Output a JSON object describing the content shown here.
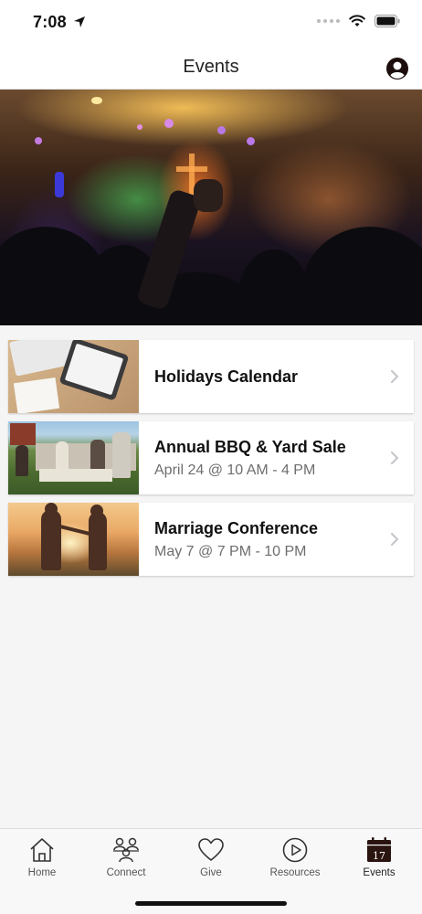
{
  "status": {
    "time": "7:08"
  },
  "header": {
    "title": "Events"
  },
  "events": [
    {
      "title": "Holidays Calendar",
      "subtitle": ""
    },
    {
      "title": "Annual BBQ & Yard Sale",
      "subtitle": "April 24 @ 10 AM - 4 PM"
    },
    {
      "title": "Marriage Conference",
      "subtitle": "May 7 @ 7 PM - 10 PM"
    }
  ],
  "tabs": [
    {
      "label": "Home",
      "icon": "home-icon"
    },
    {
      "label": "Connect",
      "icon": "people-icon"
    },
    {
      "label": "Give",
      "icon": "heart-icon"
    },
    {
      "label": "Resources",
      "icon": "play-icon"
    },
    {
      "label": "Events",
      "icon": "calendar-icon",
      "active": true,
      "day": "17"
    }
  ],
  "colors": {
    "brand": "#2a1410",
    "background": "#f5f5f5"
  }
}
